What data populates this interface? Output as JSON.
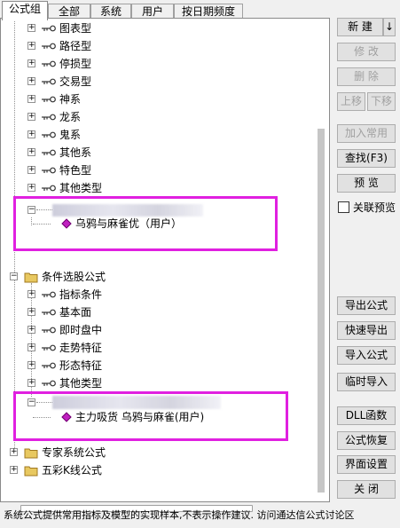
{
  "tabs": [
    {
      "label": "公式组",
      "active": true
    },
    {
      "label": "全部",
      "active": false
    },
    {
      "label": "系统",
      "active": false
    },
    {
      "label": "用户",
      "active": false
    },
    {
      "label": "按日期频度",
      "active": false
    }
  ],
  "tree": {
    "group1_items": [
      "图表型",
      "路径型",
      "停损型",
      "交易型",
      "神系",
      "龙系",
      "鬼系",
      "其他系",
      "特色型",
      "其他类型"
    ],
    "group1_user_formula": "乌鸦与麻雀优（用户）",
    "condition_group": {
      "label": "条件选股公式",
      "items": [
        "指标条件",
        "基本面",
        "即时盘中",
        "走势特征",
        "形态特征",
        "其他类型"
      ],
      "user_formula": "主力吸货  乌鸦与麻雀(用户)"
    },
    "expert_group": "专家系统公式",
    "k_group": "五彩K线公式"
  },
  "buttons": {
    "new": "新  建",
    "new_arrow": "↓",
    "modify": "修  改",
    "delete": "删  除",
    "move_up": "上移",
    "move_down": "下移",
    "add_common": "加入常用",
    "find": "查找(F3)",
    "preview": "预  览",
    "linked_preview": "关联预览",
    "export": "导出公式",
    "quick_export": "快速导出",
    "import": "导入公式",
    "temp_import": "临时导入",
    "dll": "DLL函数",
    "restore": "公式恢复",
    "ui_settings": "界面设置",
    "close": "关  闭"
  },
  "status_text": "系统公式提供常用指标及模型的实现样本,不表示操作建议.   访问通达信公式讨论区",
  "colors": {
    "highlight": "#e020e0",
    "diamond": "#c020c0"
  }
}
